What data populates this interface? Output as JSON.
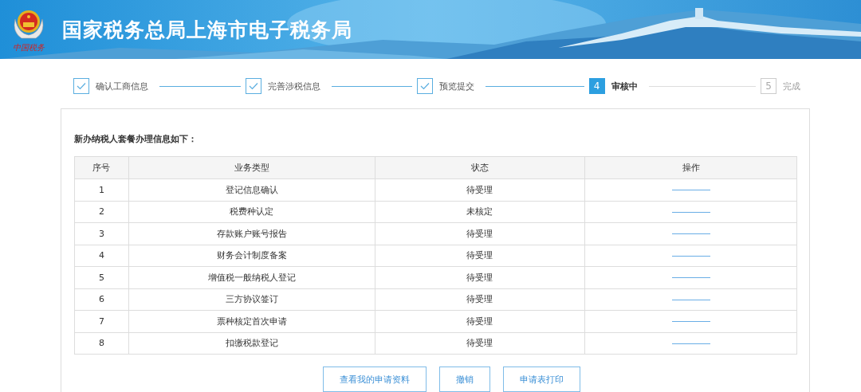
{
  "header": {
    "title": "国家税务总局上海市电子税务局",
    "logo_caption": "中国税务"
  },
  "steps": [
    {
      "label": "确认工商信息",
      "completed": true,
      "selected": false
    },
    {
      "label": "完善涉税信息",
      "completed": true,
      "selected": false
    },
    {
      "label": "预览提交",
      "completed": true,
      "selected": false
    },
    {
      "label": "审核中",
      "completed": false,
      "selected": true,
      "number": "4"
    },
    {
      "label": "完成",
      "completed": false,
      "selected": false,
      "number": "5"
    }
  ],
  "intro": "新办纳税人套餐办理信息如下：",
  "table": {
    "columns": [
      "序号",
      "业务类型",
      "状态",
      "操作"
    ],
    "rows": [
      {
        "index": "1",
        "business": "登记信息确认",
        "status": "待受理"
      },
      {
        "index": "2",
        "business": "税费种认定",
        "status": "未核定"
      },
      {
        "index": "3",
        "business": "存款账户账号报告",
        "status": "待受理"
      },
      {
        "index": "4",
        "business": "财务会计制度备案",
        "status": "待受理"
      },
      {
        "index": "5",
        "business": "增值税一般纳税人登记",
        "status": "待受理"
      },
      {
        "index": "6",
        "business": "三方协议签订",
        "status": "待受理"
      },
      {
        "index": "7",
        "business": "票种核定首次申请",
        "status": "待受理"
      },
      {
        "index": "8",
        "business": "扣缴税款登记",
        "status": "待受理"
      }
    ]
  },
  "buttons": [
    "查看我的申请资料",
    "撤销",
    "申请表打印"
  ]
}
